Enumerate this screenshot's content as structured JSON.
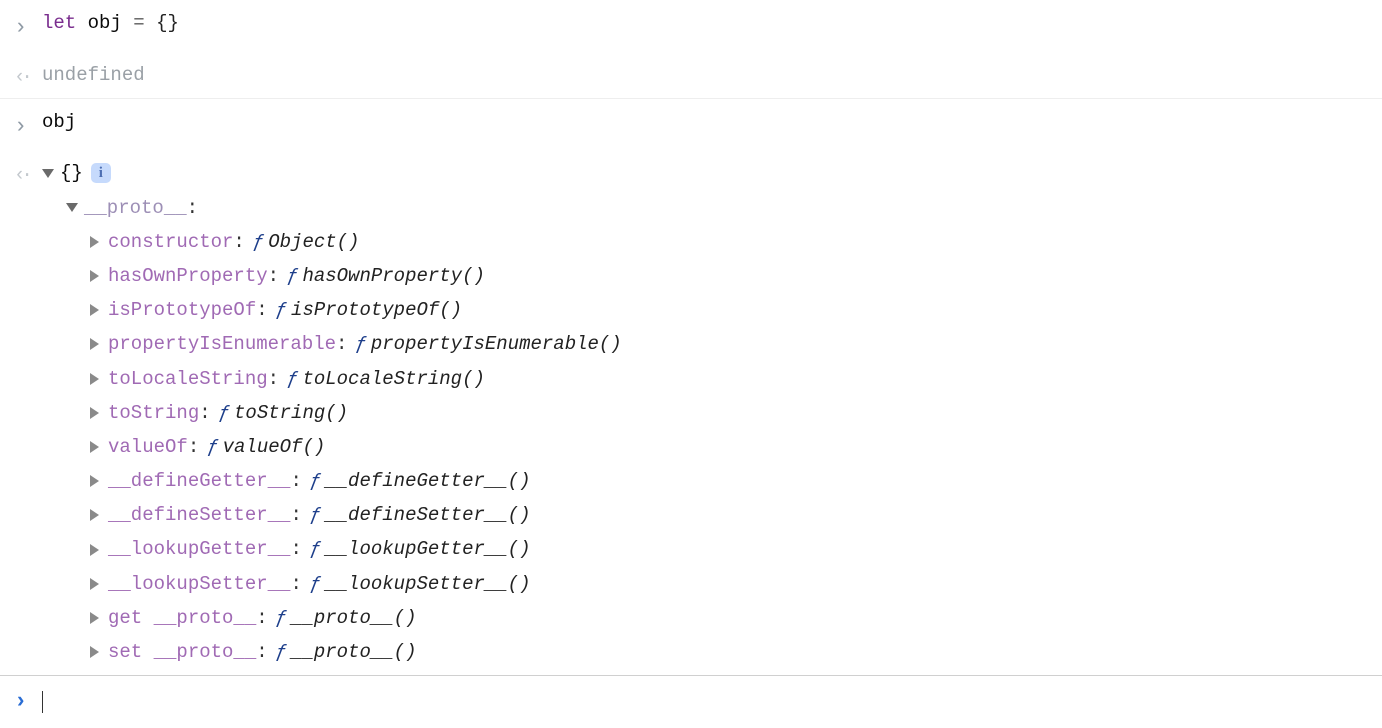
{
  "row1": {
    "kw": "let",
    "ident": "obj",
    "op": "=",
    "braces": "{}"
  },
  "row2": {
    "value": "undefined"
  },
  "row3": {
    "expr": "obj"
  },
  "obj": {
    "display": "{}",
    "info": "i",
    "proto_label": "__proto__",
    "props": [
      {
        "name": "constructor",
        "fn": "Object()"
      },
      {
        "name": "hasOwnProperty",
        "fn": "hasOwnProperty()"
      },
      {
        "name": "isPrototypeOf",
        "fn": "isPrototypeOf()"
      },
      {
        "name": "propertyIsEnumerable",
        "fn": "propertyIsEnumerable()"
      },
      {
        "name": "toLocaleString",
        "fn": "toLocaleString()"
      },
      {
        "name": "toString",
        "fn": "toString()"
      },
      {
        "name": "valueOf",
        "fn": "valueOf()"
      },
      {
        "name": "__defineGetter__",
        "fn": "__defineGetter__()"
      },
      {
        "name": "__defineSetter__",
        "fn": "__defineSetter__()"
      },
      {
        "name": "__lookupGetter__",
        "fn": "__lookupGetter__()"
      },
      {
        "name": "__lookupSetter__",
        "fn": "__lookupSetter__()"
      },
      {
        "name": "get __proto__",
        "fn": "__proto__()"
      },
      {
        "name": "set __proto__",
        "fn": "__proto__()"
      }
    ]
  },
  "f_glyph": "ƒ"
}
